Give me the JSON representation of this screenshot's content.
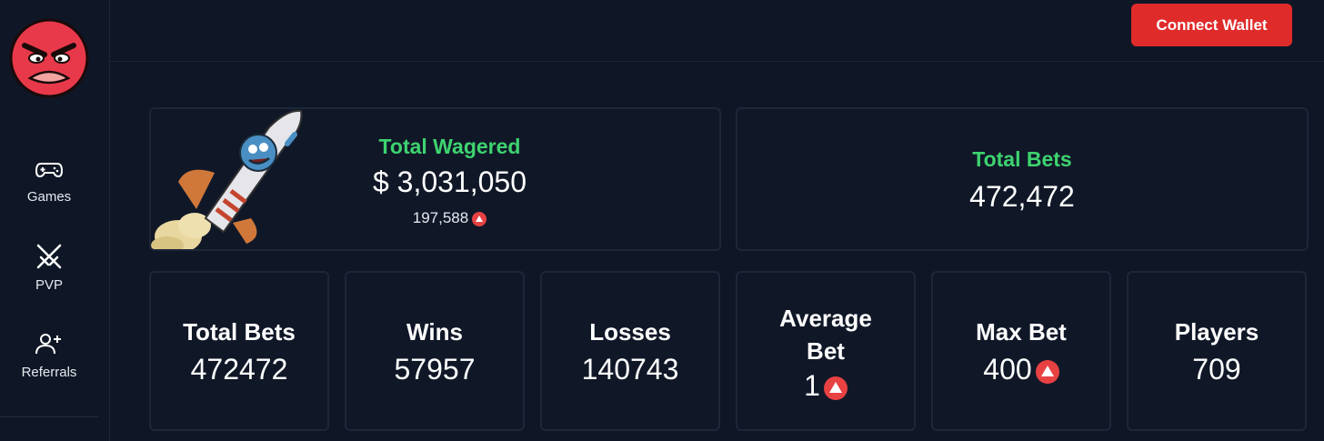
{
  "header": {
    "connect_label": "Connect Wallet"
  },
  "sidebar": {
    "items": [
      {
        "label": "Games",
        "icon": "gamepad-icon"
      },
      {
        "label": "PVP",
        "icon": "crossed-swords-icon"
      },
      {
        "label": "Referrals",
        "icon": "add-users-icon"
      }
    ]
  },
  "summary": {
    "wagered_title": "Total Wagered",
    "wagered_value": "$ 3,031,050",
    "wagered_avax": "197,588",
    "bets_title": "Total Bets",
    "bets_value": "472,472"
  },
  "stats": [
    {
      "label": "Total Bets",
      "value": "472472"
    },
    {
      "label": "Wins",
      "value": "57957"
    },
    {
      "label": "Losses",
      "value": "140743"
    },
    {
      "label": "Average Bet",
      "value": "1"
    },
    {
      "label": "Max Bet",
      "value": "400"
    },
    {
      "label": "Players",
      "value": "709"
    }
  ],
  "colors": {
    "background": "#0f1726",
    "accent_red": "#e02b2b",
    "accent_green": "#3ed36f",
    "avax_red": "#e84142"
  }
}
